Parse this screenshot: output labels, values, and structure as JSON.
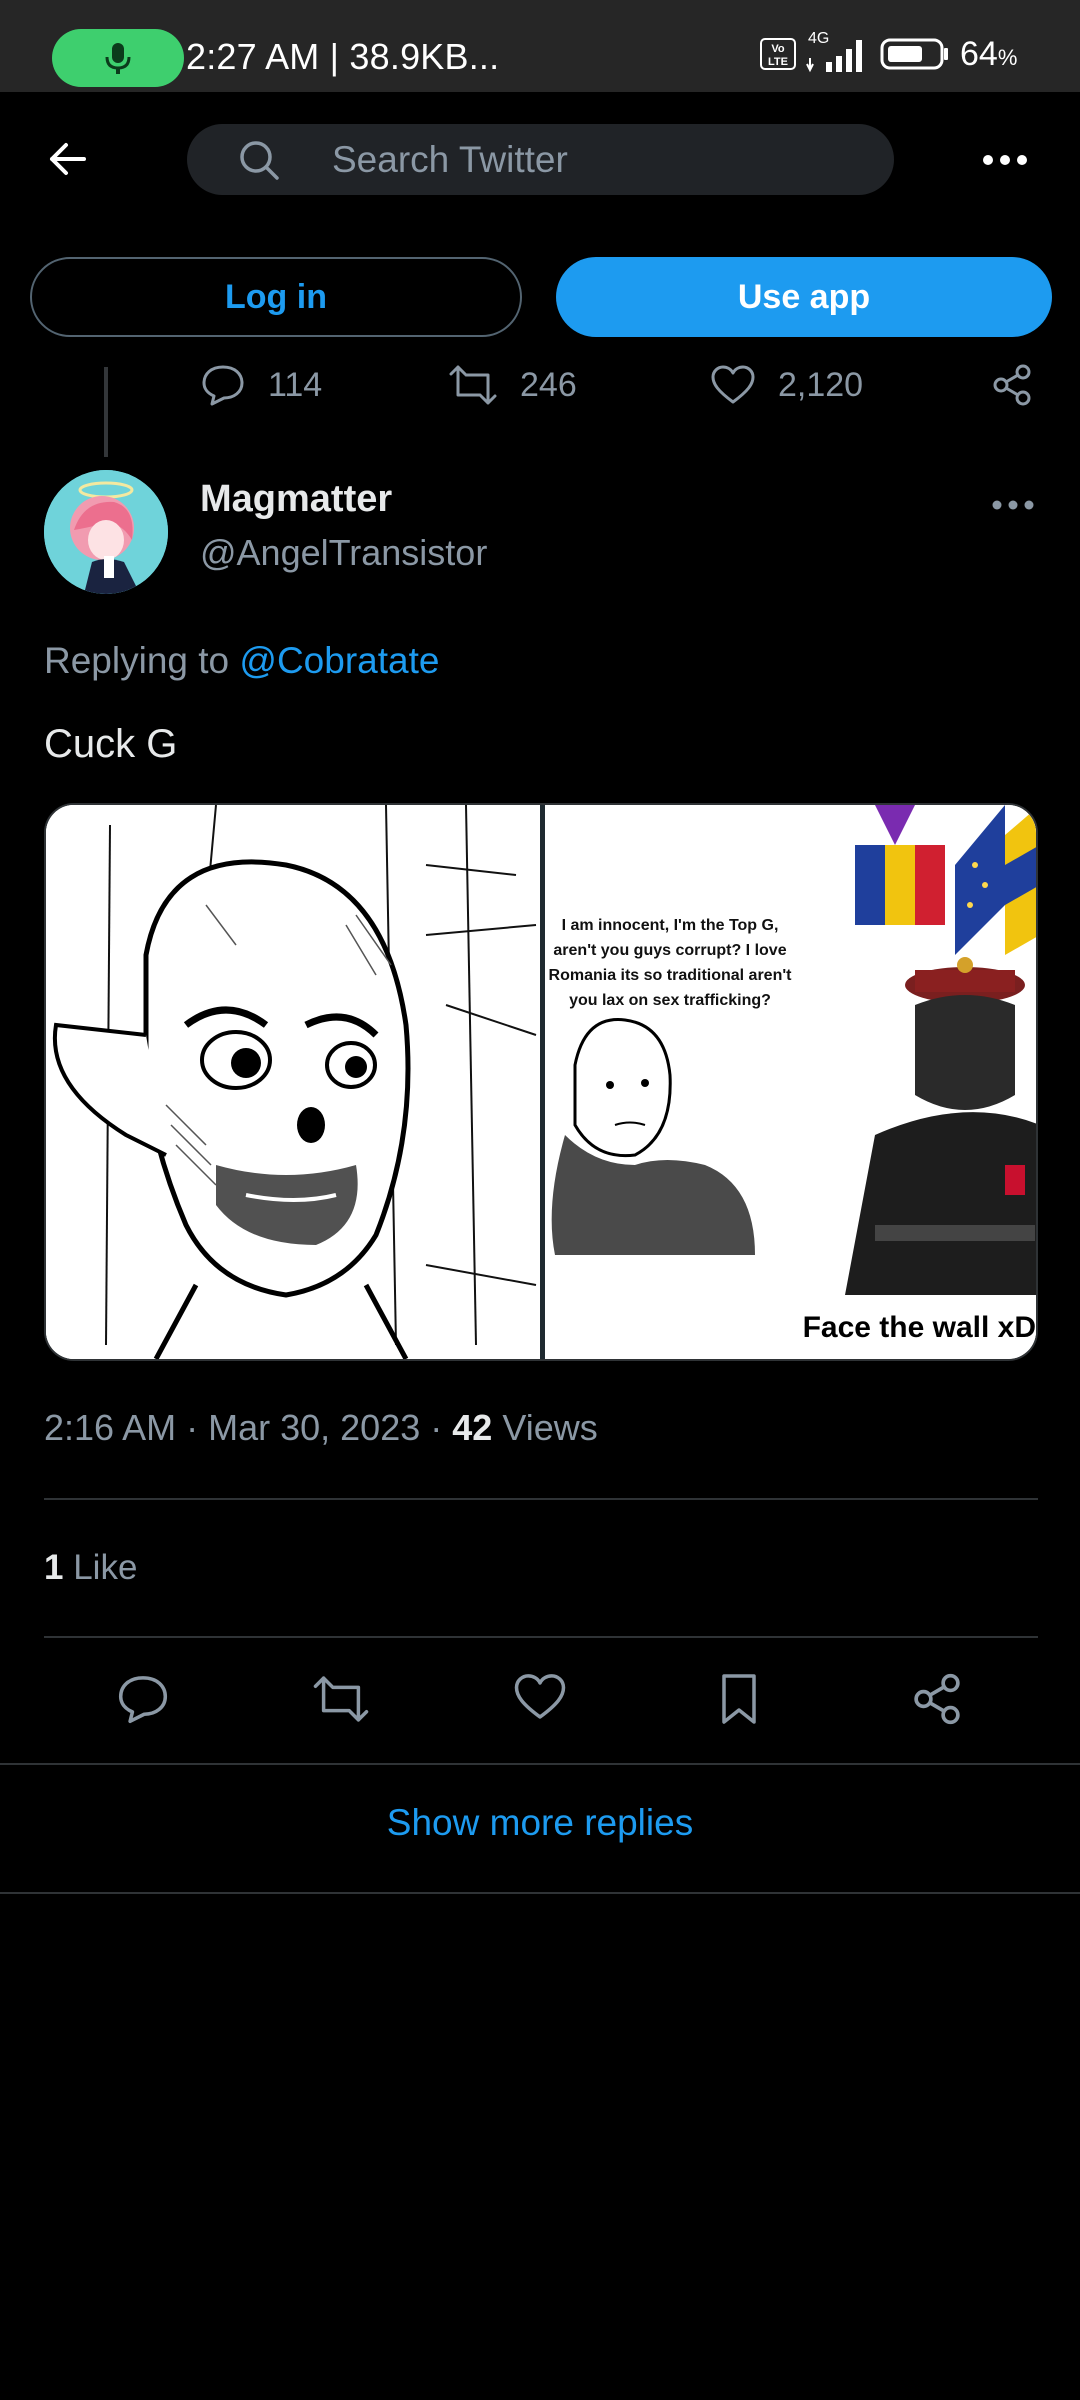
{
  "status_bar": {
    "time_and_speed": "2:27 AM | 38.9KB...",
    "network": "4G",
    "volte": "Vo LTE",
    "battery_pct": "64",
    "battery_unit": "%"
  },
  "topbar": {
    "search_placeholder": "Search Twitter"
  },
  "auth_buttons": {
    "login": "Log in",
    "use_app": "Use app"
  },
  "parent_tweet_stats": {
    "replies": "114",
    "retweets": "246",
    "likes": "2,120"
  },
  "tweet": {
    "author_name": "Magmatter",
    "author_handle": "@AngelTransistor",
    "replying_prefix": "Replying to",
    "replying_to": "@Cobratate",
    "text": "Cuck G",
    "media": {
      "right_caption": "I am innocent, I'm the Top G, aren't you guys corrupt? I love Romania its so traditional aren't you lax on sex trafficking?",
      "right_bottom_text": "Face the wall xD"
    },
    "time": "2:16 AM",
    "date": "Mar 30, 2023",
    "views_count": "42",
    "views_label": "Views",
    "likes_count": "1",
    "likes_label": "Like"
  },
  "show_more_replies": "Show more replies",
  "colors": {
    "accent": "#1d9bf0",
    "background": "#000000",
    "secondary_text": "#8b98a5",
    "divider": "#2f3336"
  }
}
